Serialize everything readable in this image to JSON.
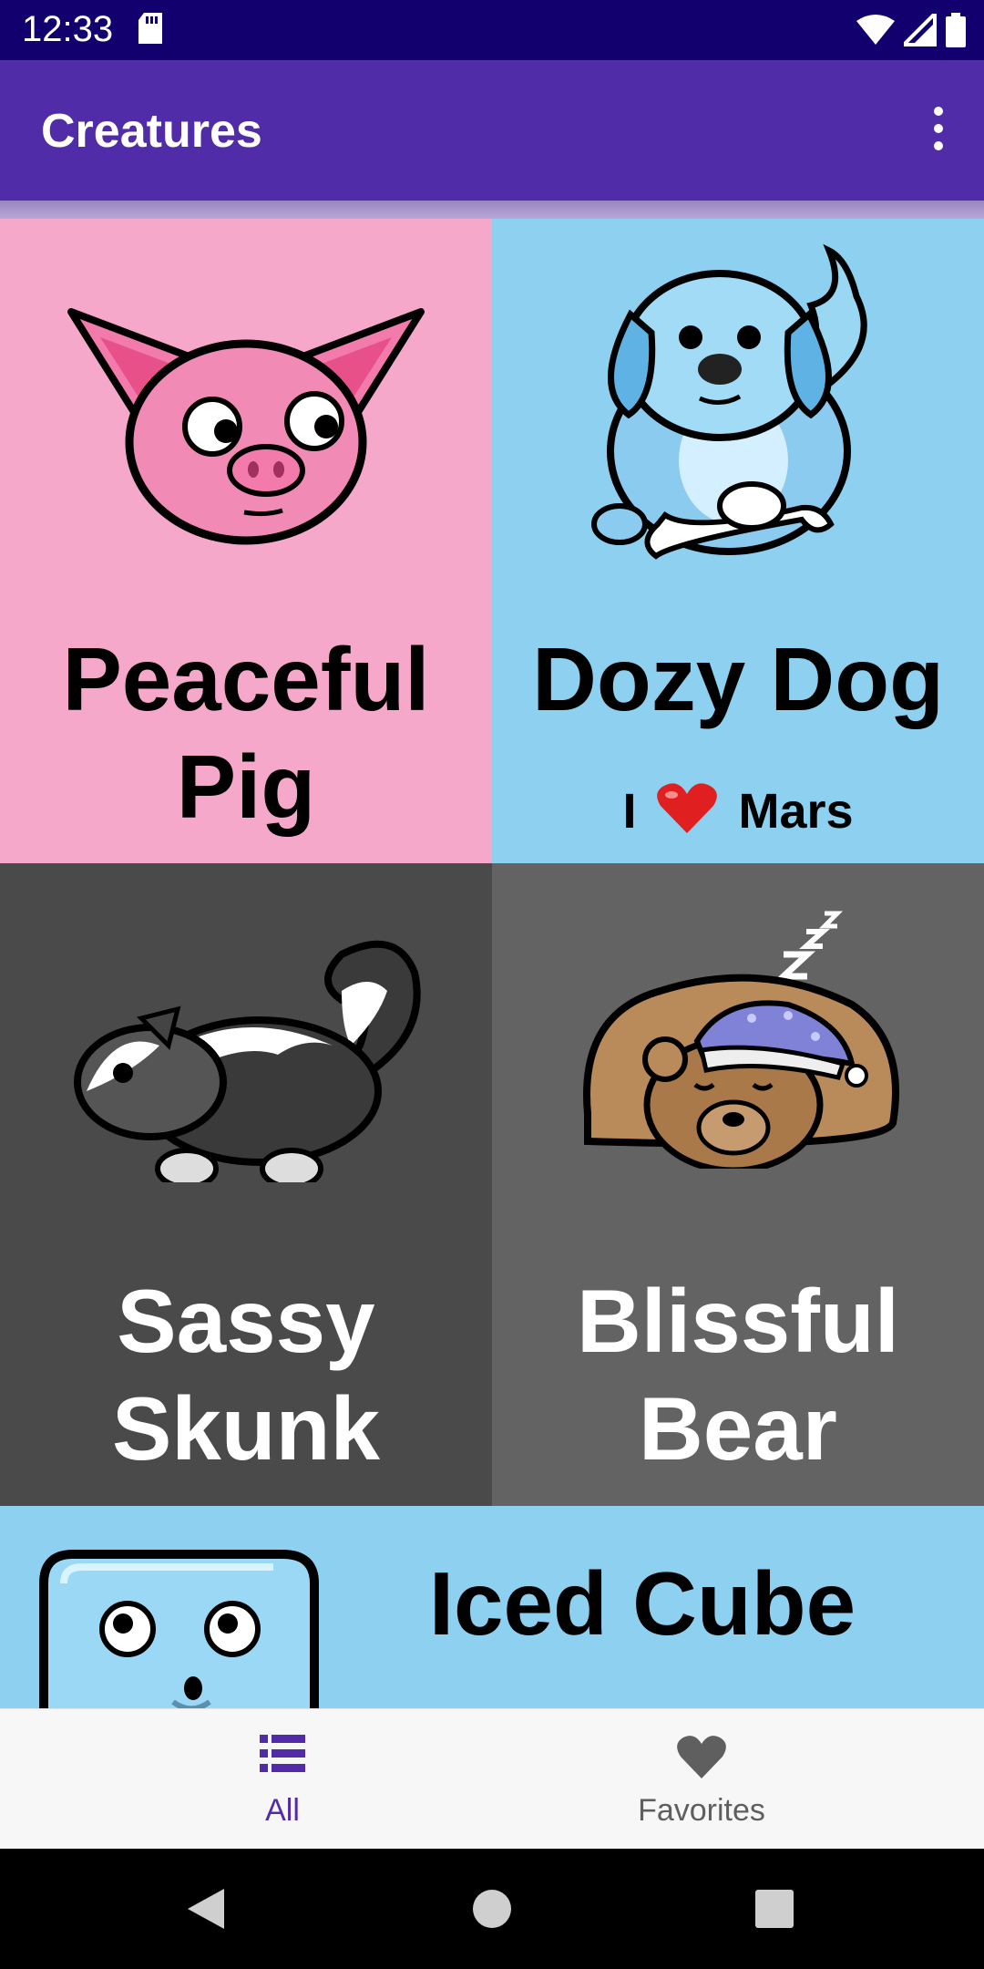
{
  "status_bar": {
    "time": "12:33",
    "icons": [
      "sd-card-icon",
      "wifi-icon",
      "cell-signal-icon",
      "battery-icon"
    ]
  },
  "app_bar": {
    "title": "Creatures",
    "menu_icon": "more-vert-icon"
  },
  "colors": {
    "status_bar": "#12006e",
    "app_bar": "#512ca8",
    "accent": "#512ca8",
    "pink_card": "#f5a8c9",
    "blue_card": "#8dd0ef",
    "dark_gray_card": "#4a4a4a",
    "gray_card": "#636363",
    "nav_inactive": "#5f5f5f"
  },
  "creatures": [
    {
      "name_lines": [
        "Peaceful",
        "Pig"
      ],
      "subtitle": "",
      "icon": "pig-icon"
    },
    {
      "name_lines": [
        "Dozy Dog"
      ],
      "subtitle_prefix": "I",
      "subtitle_suffix": "Mars",
      "subtitle_icon": "heart-icon",
      "icon": "dog-icon"
    },
    {
      "name_lines": [
        "Sassy",
        "Skunk"
      ],
      "subtitle": "",
      "icon": "skunk-icon"
    },
    {
      "name_lines": [
        "Blissful",
        "Bear"
      ],
      "subtitle": "",
      "icon": "bear-icon"
    },
    {
      "name_lines": [
        "Iced Cube"
      ],
      "subtitle": "",
      "icon": "ice-cube-icon"
    }
  ],
  "bottom_nav": {
    "items": [
      {
        "label": "All",
        "icon": "list-icon",
        "selected": true
      },
      {
        "label": "Favorites",
        "icon": "heart-icon",
        "selected": false
      }
    ]
  },
  "system_nav": {
    "icons": [
      "back-icon",
      "home-icon",
      "recents-icon"
    ]
  }
}
